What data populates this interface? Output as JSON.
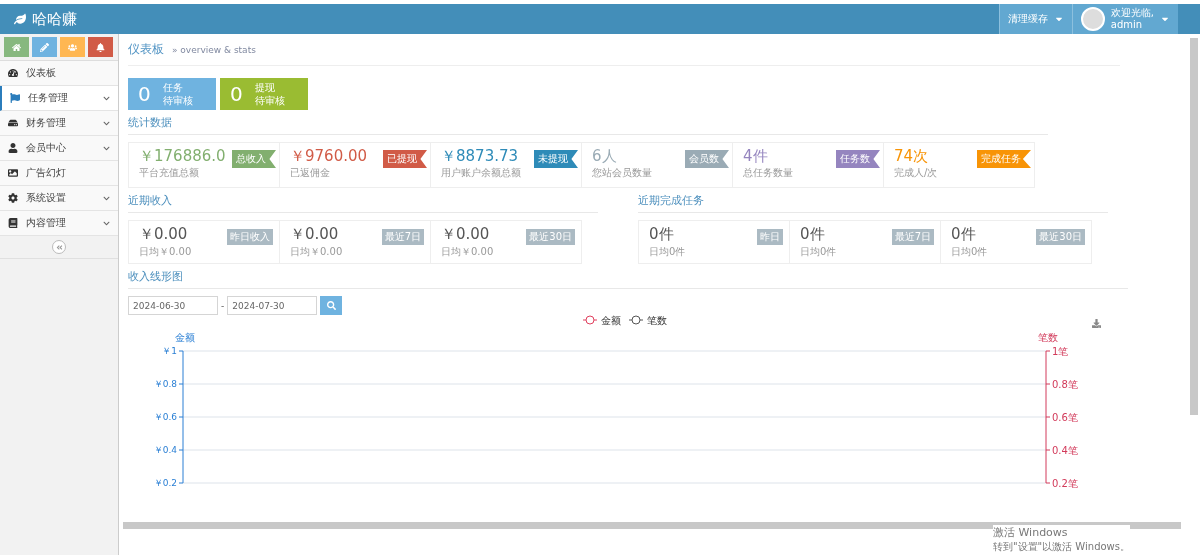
{
  "header": {
    "logo": "哈哈赚",
    "cache_menu": "清理缓存",
    "user": {
      "greeting": "欢迎光临,",
      "name": "admin"
    }
  },
  "shortcuts": [
    {
      "kind": "home",
      "color": "#87b87f"
    },
    {
      "kind": "edit",
      "color": "#6fb3e0"
    },
    {
      "kind": "users",
      "color": "#ffb752"
    },
    {
      "kind": "bell",
      "color": "#d15b47"
    }
  ],
  "sidebar": {
    "items": [
      {
        "label": "仪表板",
        "kind": "dashboard",
        "has_submenu": false,
        "selected": false
      },
      {
        "label": "任务管理",
        "kind": "flag",
        "has_submenu": true,
        "selected": true
      },
      {
        "label": "财务管理",
        "kind": "drive",
        "has_submenu": true,
        "selected": false
      },
      {
        "label": "会员中心",
        "kind": "user",
        "has_submenu": true,
        "selected": false
      },
      {
        "label": "广告幻灯",
        "kind": "image",
        "has_submenu": false,
        "selected": false
      },
      {
        "label": "系统设置",
        "kind": "gear",
        "has_submenu": true,
        "selected": false
      },
      {
        "label": "内容管理",
        "kind": "book",
        "has_submenu": true,
        "selected": false
      }
    ]
  },
  "breadcrumb": {
    "title": "仪表板",
    "subtitle": "» overview & stats"
  },
  "pending": [
    {
      "count": "0",
      "line1": "任务",
      "line2": "待审核",
      "color": "#6fb3e0"
    },
    {
      "count": "0",
      "line1": "提现",
      "line2": "待审核",
      "color": "#9abc32"
    }
  ],
  "stats": {
    "title": "统计数据",
    "cards": [
      {
        "value": "￥176886.0",
        "caption": "平台充值总额",
        "tag": "总收入",
        "color": "#82af6f"
      },
      {
        "value": "￥9760.00",
        "caption": "已返佣金",
        "tag": "已提现",
        "color": "#d15b47"
      },
      {
        "value": "￥8873.73",
        "caption": "用户账户余额总额",
        "tag": "未提现",
        "color": "#2e8bb8"
      },
      {
        "value": "6人",
        "caption": "您站会员数量",
        "tag": "会员数",
        "color": "#9aabb5"
      },
      {
        "value": "4件",
        "caption": "总任务数量",
        "tag": "任务数",
        "color": "#9585bf"
      },
      {
        "value": "74次",
        "caption": "完成人/次",
        "tag": "完成任务",
        "color": "#f89406"
      }
    ]
  },
  "recent_income": {
    "title": "近期收入",
    "cards": [
      {
        "value": "￥0.00",
        "caption": "日均￥0.00",
        "tag": "昨日收入"
      },
      {
        "value": "￥0.00",
        "caption": "日均￥0.00",
        "tag": "最近7日"
      },
      {
        "value": "￥0.00",
        "caption": "日均￥0.00",
        "tag": "最近30日"
      }
    ]
  },
  "recent_tasks": {
    "title": "近期完成任务",
    "cards": [
      {
        "value": "0件",
        "caption": "日均0件",
        "tag": "昨日"
      },
      {
        "value": "0件",
        "caption": "日均0件",
        "tag": "最近7日"
      },
      {
        "value": "0件",
        "caption": "日均0件",
        "tag": "最近30日"
      }
    ]
  },
  "income_chart": {
    "title": "收入线形图",
    "date_from": "2024-06-30",
    "date_to": "2024-07-30",
    "separator": "-",
    "chart_data": {
      "type": "line",
      "ylabel": "金额",
      "y2label": "笔数",
      "ylim": [
        0.2,
        1
      ],
      "y2lim": [
        0.2,
        1
      ],
      "grid": true,
      "yticks": [
        {
          "value": 1,
          "label": "￥1"
        },
        {
          "value": 0.8,
          "label": "￥0.8"
        },
        {
          "value": 0.6,
          "label": "￥0.6"
        },
        {
          "value": 0.4,
          "label": "￥0.4"
        },
        {
          "value": 0.2,
          "label": "￥0.2"
        }
      ],
      "y2ticks": [
        {
          "value": 1,
          "label": "1笔"
        },
        {
          "value": 0.8,
          "label": "0.8笔"
        },
        {
          "value": 0.6,
          "label": "0.6笔"
        },
        {
          "value": 0.4,
          "label": "0.4笔"
        },
        {
          "value": 0.2,
          "label": "0.2笔"
        }
      ],
      "series": [
        {
          "name": "金额",
          "color": "#e0405e"
        },
        {
          "name": "笔数",
          "color": "#555555"
        }
      ]
    }
  },
  "windows_notice": {
    "line1": "激活 Windows",
    "line2": "转到\"设置\"以激活 Windows。"
  }
}
